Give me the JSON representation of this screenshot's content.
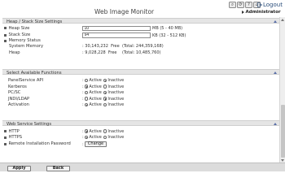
{
  "app": {
    "title": "Web Image Monitor"
  },
  "topbar": {
    "icons": [
      {
        "name": "search-icon",
        "glyph": "⌕"
      },
      {
        "name": "refresh-icon",
        "glyph": "⟳"
      },
      {
        "name": "help-icon",
        "glyph": "?"
      },
      {
        "name": "home-icon",
        "glyph": "⌂"
      }
    ],
    "logout_label": "Logout",
    "user_label": "Administrator"
  },
  "heap": {
    "title": "Heap / Stack Size Settings",
    "heap_size_label": "Heap Size",
    "heap_size_value": "10",
    "heap_size_unit": "MB (5 - 40 MB)",
    "stack_size_label": "Stack Size",
    "stack_size_value": "64",
    "stack_size_unit": "KB (32 - 512 KB)",
    "memory_status_label": "Memory Status",
    "system_memory_label": "System Memory",
    "system_memory_free": ": 30,143,232  Free",
    "system_memory_total": "(Total: 244,359,168)",
    "heap_label": "Heap",
    "heap_free": ": 9,028,228  Free",
    "heap_total": "(Total: 10,485,760)"
  },
  "functions": {
    "title": "Select Available Functions",
    "active_label": "Active",
    "inactive_label": "Inactive",
    "items": [
      {
        "label": "PanelService API",
        "selected": "inactive"
      },
      {
        "label": "Kerberos",
        "selected": "active"
      },
      {
        "label": "PC/SC",
        "selected": "inactive"
      },
      {
        "label": "JNDI/LDAP",
        "selected": "inactive"
      },
      {
        "label": "Activation",
        "selected": "active"
      }
    ]
  },
  "web_service": {
    "title": "Web Service Settings",
    "active_label": "Active",
    "inactive_label": "Inactive",
    "http_label": "HTTP",
    "http_selected": "active",
    "https_label": "HTTPS",
    "https_selected": "active",
    "remote_password_label": "Remote Installation Password",
    "change_label": "Change"
  },
  "footer": {
    "apply_label": "Apply",
    "back_label": "Back"
  },
  "colors": {
    "section_header_bg": "#e5e5e5",
    "footer_bg": "#dcdcdc",
    "accent": "#5a6fa8"
  }
}
